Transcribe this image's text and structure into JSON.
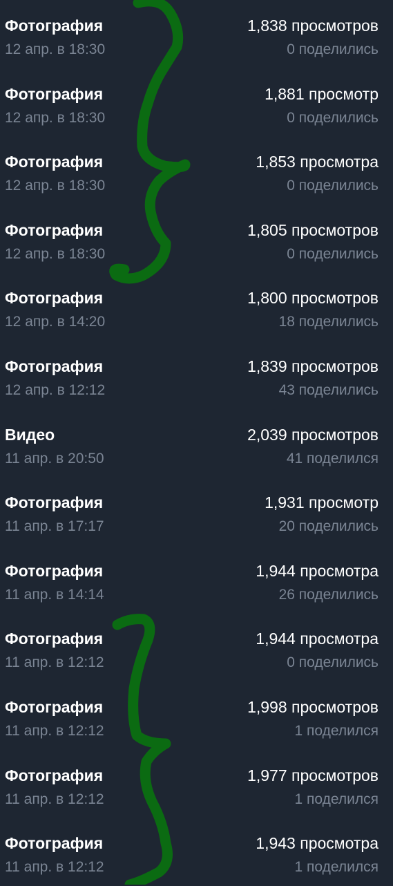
{
  "posts": [
    {
      "type": "Фотография",
      "date": "12 апр. в 18:30",
      "views": "1,838 просмотров",
      "shares": "0 поделились"
    },
    {
      "type": "Фотография",
      "date": "12 апр. в 18:30",
      "views": "1,881 просмотр",
      "shares": "0 поделились"
    },
    {
      "type": "Фотография",
      "date": "12 апр. в 18:30",
      "views": "1,853 просмотра",
      "shares": "0 поделились"
    },
    {
      "type": "Фотография",
      "date": "12 апр. в 18:30",
      "views": "1,805 просмотров",
      "shares": "0 поделились"
    },
    {
      "type": "Фотография",
      "date": "12 апр. в 14:20",
      "views": "1,800 просмотров",
      "shares": "18 поделились"
    },
    {
      "type": "Фотография",
      "date": "12 апр. в 12:12",
      "views": "1,839 просмотров",
      "shares": "43 поделились"
    },
    {
      "type": "Видео",
      "date": "11 апр. в 20:50",
      "views": "2,039 просмотров",
      "shares": "41 поделился"
    },
    {
      "type": "Фотография",
      "date": "11 апр. в 17:17",
      "views": "1,931 просмотр",
      "shares": "20 поделились"
    },
    {
      "type": "Фотография",
      "date": "11 апр. в 14:14",
      "views": "1,944 просмотра",
      "shares": "26 поделились"
    },
    {
      "type": "Фотография",
      "date": "11 апр. в 12:12",
      "views": "1,944 просмотра",
      "shares": "0 поделились"
    },
    {
      "type": "Фотография",
      "date": "11 апр. в 12:12",
      "views": "1,998 просмотров",
      "shares": "1 поделился"
    },
    {
      "type": "Фотография",
      "date": "11 апр. в 12:12",
      "views": "1,977 просмотров",
      "shares": "1 поделился"
    },
    {
      "type": "Фотография",
      "date": "11 апр. в 12:12",
      "views": "1,943 просмотра",
      "shares": "1 поделился"
    }
  ],
  "annotation": {
    "color": "#0b6b12",
    "shape": "curly-brace",
    "marks": 2
  }
}
